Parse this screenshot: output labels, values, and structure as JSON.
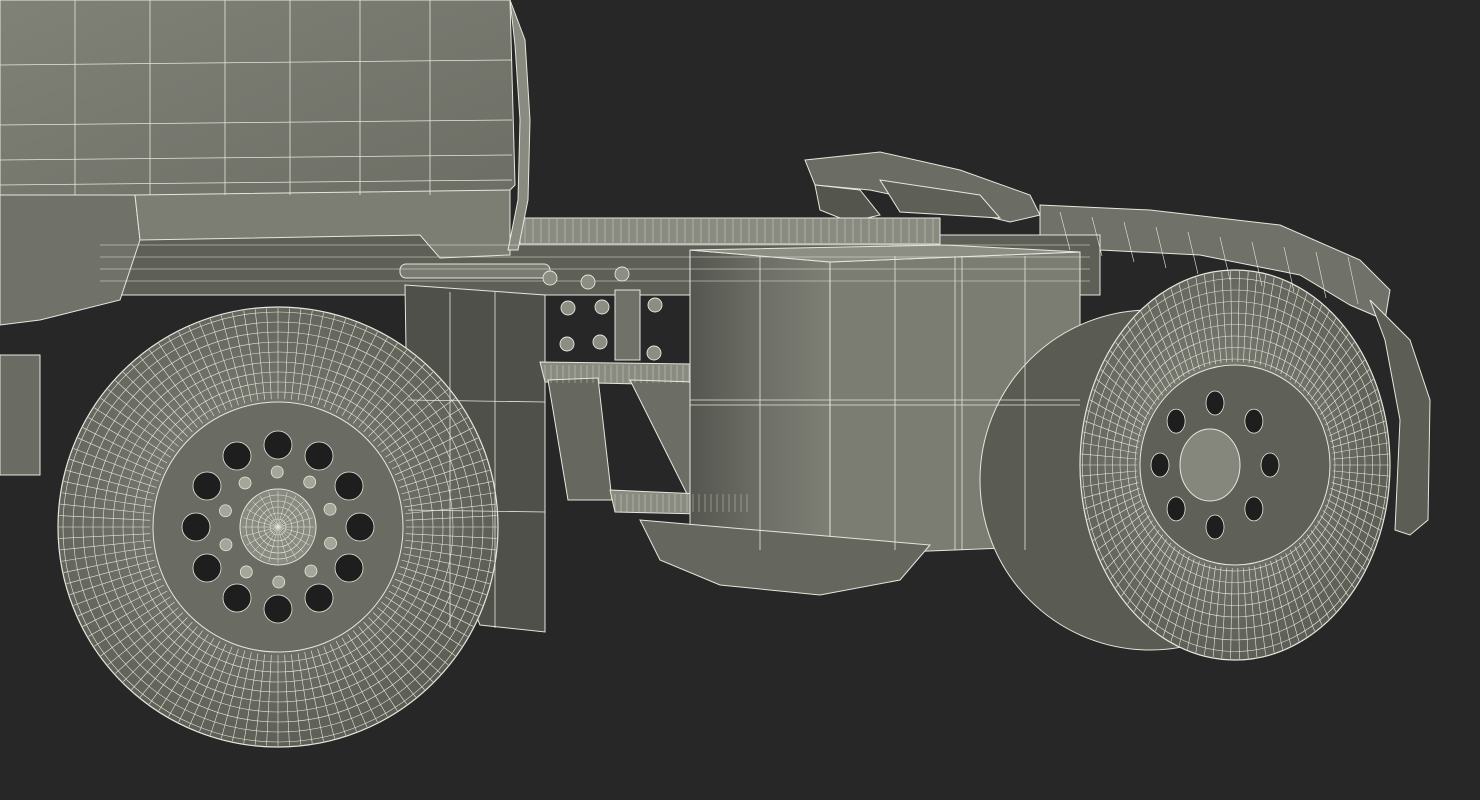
{
  "scene": {
    "subject": "truck-tractor-wireframe-render",
    "colors": {
      "background": "#272727",
      "body_fill": "#7a7b71",
      "body_dark": "#56574f",
      "tire_fill": "#6e6f66",
      "tire_dark": "#4a4b45",
      "hole": "#1e1e1e",
      "wire": "#e6e6dc",
      "wire_soft": "#cfd0c4"
    }
  }
}
